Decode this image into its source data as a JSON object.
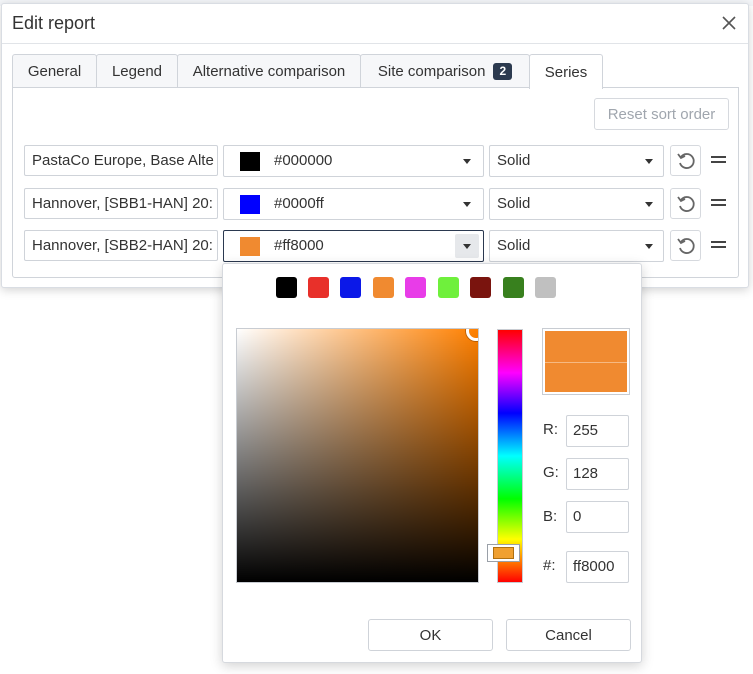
{
  "dialog": {
    "title": "Edit report",
    "close_icon": "close-icon"
  },
  "tabs": [
    {
      "label": "General",
      "active": false
    },
    {
      "label": "Legend",
      "active": false
    },
    {
      "label": "Alternative comparison",
      "active": false
    },
    {
      "label": "Site comparison",
      "badge": "2",
      "active": false
    },
    {
      "label": "Series",
      "active": true
    }
  ],
  "series_panel": {
    "reset_sort_label": "Reset sort order",
    "rows": [
      {
        "name": "PastaCo Europe, Base Alte",
        "color_hex": "#000000",
        "swatch": "#000000",
        "line_style": "Solid"
      },
      {
        "name": "Hannover, [SBB1-HAN] 20:",
        "color_hex": "#0000ff",
        "swatch": "#0000ff",
        "line_style": "Solid"
      },
      {
        "name": "Hannover, [SBB2-HAN] 20:",
        "color_hex": "#ff8000",
        "swatch": "#f08a30",
        "line_style": "Solid"
      }
    ],
    "undo_icon": "undo-icon",
    "drag_icon": "drag-handle-icon"
  },
  "color_picker": {
    "presets": [
      "#000000",
      "#e8302a",
      "#0b18e8",
      "#f08a30",
      "#e83ce8",
      "#6ff03c",
      "#7a140e",
      "#38801e",
      "#c0c0c0"
    ],
    "hue_color": "#ff8000",
    "preview_color": "#f08a30",
    "r_label": "R:",
    "r_value": "255",
    "g_label": "G:",
    "g_value": "128",
    "b_label": "B:",
    "b_value": "0",
    "hex_label": "#:",
    "hex_value": "ff8000",
    "ok_label": "OK",
    "cancel_label": "Cancel"
  }
}
